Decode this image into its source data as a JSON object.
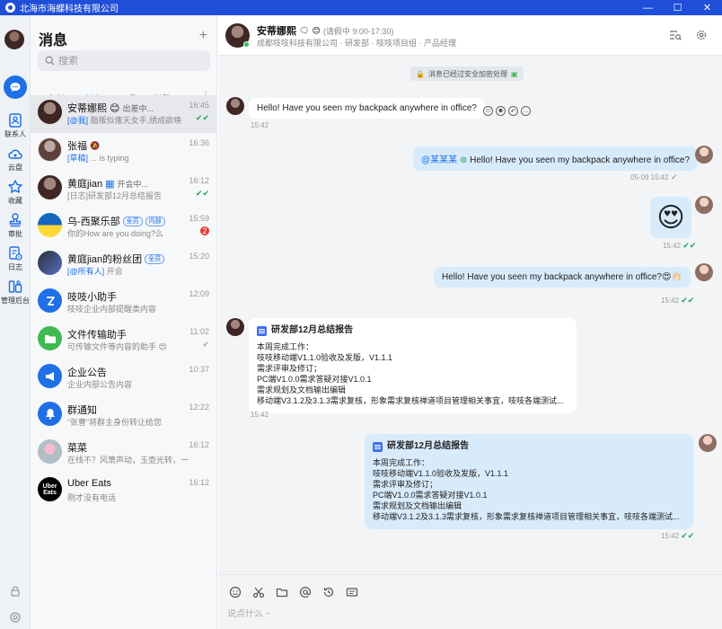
{
  "window": {
    "title": "北海市海蝶科技有限公司",
    "minimize": "—",
    "maximize": "☐",
    "close": "✕"
  },
  "rail": {
    "items": [
      {
        "label": "联系人"
      },
      {
        "label": "云盘"
      },
      {
        "label": "收藏"
      },
      {
        "label": "审批"
      },
      {
        "label": "日志"
      },
      {
        "label": "管理后台"
      }
    ]
  },
  "list": {
    "heading": "消息",
    "plus": "+",
    "search_placeholder": "搜索",
    "tabs": [
      {
        "label": "全部"
      },
      {
        "label": "未读"
      },
      {
        "label": "@我"
      },
      {
        "label": "单聊"
      }
    ],
    "more": "⋮",
    "conversations": [
      {
        "name": "安蒂娜熙",
        "status": "出差中...",
        "tag": "[@我]",
        "preview": "脂叛似傕天女手,绣成欲唤",
        "time": "16:45"
      },
      {
        "name": "张福",
        "tag": "[草稿]",
        "preview": "... is typing",
        "time": "16:36"
      },
      {
        "name": "黄庭jian",
        "status": "开会中...",
        "tag": "[日志]",
        "preview": "研发部12月总结报告",
        "time": "16:12"
      },
      {
        "name": "乌-西聚乐部",
        "badge1": "全员",
        "badge2": "内部",
        "preview": "你的How are you doing?么",
        "time": "15:59",
        "unread": "2"
      },
      {
        "name": "黄庭jian的粉丝团",
        "badge1": "全员",
        "tag": "[@所有人]",
        "preview": "开会",
        "time": "15:20"
      },
      {
        "name": "吱吱小助手",
        "preview": "吱吱企业内部提醒类内容",
        "time": "12:09"
      },
      {
        "name": "文件传输助手",
        "preview": "可传输文件等内容的助手",
        "time": "11:02"
      },
      {
        "name": "企业公告",
        "preview": "企业内部公告内容",
        "time": "10:37"
      },
      {
        "name": "群通知",
        "preview": "“张曹”将群主身份转让给您",
        "time": "12:22"
      },
      {
        "name": "菜菜",
        "preview": "在线不？风箫声动，玉壶光转，一夜...",
        "time": "16:12"
      },
      {
        "name": "Uber Eats",
        "preview": "刚才没有电话",
        "time": "16:12"
      }
    ]
  },
  "chat": {
    "contact_name": "安蒂娜熙",
    "contact_status": "(请假中 9:00-17:30)",
    "org": "成都吱吱科技有限公司 · 研发部 · 吱吱项目组 · 产品经理",
    "notice": "消息已经过安全加密处理",
    "messages": [
      {
        "text": "Hello! Have you seen my backpack anywhere in office?",
        "time": "15:42"
      },
      {
        "mention": "@某某某",
        "text": "Hello! Have you seen my backpack anywhere in office?",
        "time": "05-09 15:42"
      },
      {
        "emoji": "😍",
        "time": "15:42"
      },
      {
        "text": "Hello! Have you seen my backpack anywhere in office?",
        "emoji": "😍👏🏻",
        "time": "15:42"
      }
    ],
    "report": {
      "title": "研发部12月总结报告",
      "lines": [
        "本周完成工作：",
        "吱吱移动端V1.1.0验收及发版，V1.1.1",
        "需求评审及修订；",
        "PC端V1.0.0需求答疑对接V1.0.1",
        "需求规划及文档输出编辑",
        "移动端V3.1.2及3.1.3需求复核，形象需求复核禅道项目管理相关事宜，吱吱各端测试..."
      ],
      "time_in": "15:42",
      "time_out": "15:42"
    },
    "composer_placeholder": "说点什么 ~"
  },
  "colors": {
    "titlebar": "#1f4ed8",
    "accent": "#1f6fe5",
    "outgoing_bubble": "#d8ebfb"
  }
}
